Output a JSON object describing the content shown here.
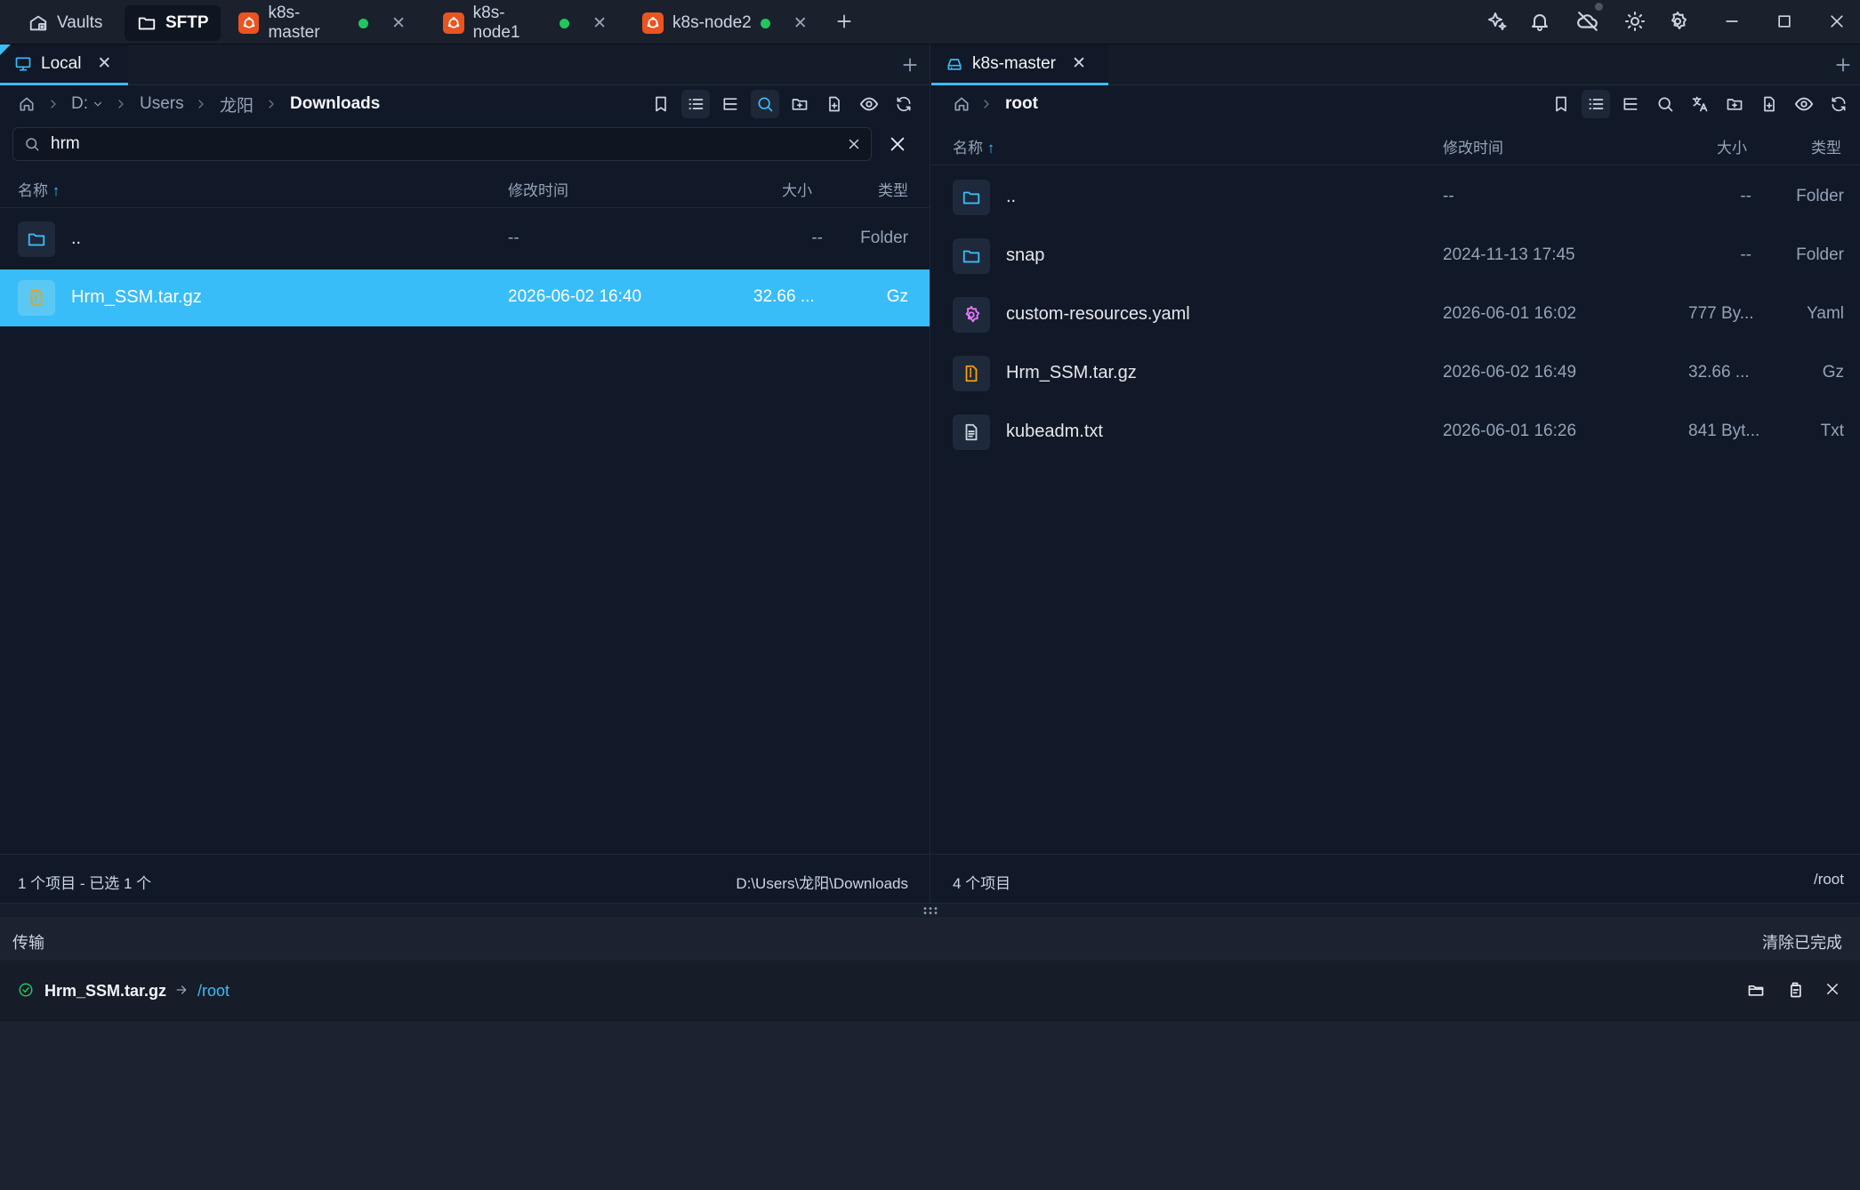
{
  "window": {
    "tabs": [
      {
        "label": "Vaults",
        "icon": "vault-icon"
      },
      {
        "label": "SFTP",
        "icon": "folder-icon",
        "active": true
      },
      {
        "label": "k8s-master",
        "icon": "ubuntu-icon",
        "connected": true
      },
      {
        "label": "k8s-node1",
        "icon": "ubuntu-icon",
        "connected": true
      },
      {
        "label": "k8s-node2",
        "icon": "ubuntu-icon",
        "connected": true
      }
    ],
    "right_icons": [
      "ai-sparkle-icon",
      "bell-icon",
      "cloud-off-icon",
      "sun-icon",
      "gear-icon",
      "minimize-icon",
      "maximize-icon",
      "close-icon"
    ]
  },
  "colors": {
    "accent": "#38bdf8",
    "selected_row": "#38bdf8",
    "connected_dot": "#22c55e",
    "ubuntu": "#e95420",
    "yaml_icon": "#e879f9",
    "archive_icon": "#f59e0b"
  },
  "left": {
    "tab_label": "Local",
    "breadcrumb": {
      "drive": "D:",
      "items": [
        "Users",
        "龙阳",
        "Downloads"
      ]
    },
    "search_value": "hrm",
    "columns": {
      "name": "名称",
      "modified": "修改时间",
      "size": "大小",
      "type": "类型"
    },
    "rows": [
      {
        "name": "..",
        "modified": "--",
        "size": "--",
        "type": "Folder",
        "icon": "folder-icon"
      },
      {
        "name": "Hrm_SSM.tar.gz",
        "modified": "2026-06-02 16:40",
        "size": "32.66 ...",
        "type": "Gz",
        "icon": "archive-icon",
        "selected": true
      }
    ],
    "status_count": "1 个项目 - 已选 1 个",
    "status_path": "D:\\Users\\龙阳\\Downloads"
  },
  "right": {
    "tab_label": "k8s-master",
    "breadcrumb": {
      "items": [
        "root"
      ]
    },
    "columns": {
      "name": "名称",
      "modified": "修改时间",
      "size": "大小",
      "type": "类型"
    },
    "rows": [
      {
        "name": "..",
        "modified": "--",
        "size": "--",
        "type": "Folder",
        "icon": "folder-icon"
      },
      {
        "name": "snap",
        "modified": "2024-11-13 17:45",
        "size": "--",
        "type": "Folder",
        "icon": "folder-icon"
      },
      {
        "name": "custom-resources.yaml",
        "modified": "2026-06-01 16:02",
        "size": "777 By...",
        "type": "Yaml",
        "icon": "yaml-gear-icon"
      },
      {
        "name": "Hrm_SSM.tar.gz",
        "modified": "2026-06-02 16:49",
        "size": "32.66 ...",
        "type": "Gz",
        "icon": "archive-icon"
      },
      {
        "name": "kubeadm.txt",
        "modified": "2026-06-01 16:26",
        "size": "841 Byt...",
        "type": "Txt",
        "icon": "text-file-icon"
      }
    ],
    "status_count": "4 个项目",
    "status_path": "/root"
  },
  "transfer": {
    "title": "传输",
    "clear_label": "清除已完成",
    "items": [
      {
        "file": "Hrm_SSM.tar.gz",
        "dest": "/root",
        "status": "done"
      }
    ]
  }
}
